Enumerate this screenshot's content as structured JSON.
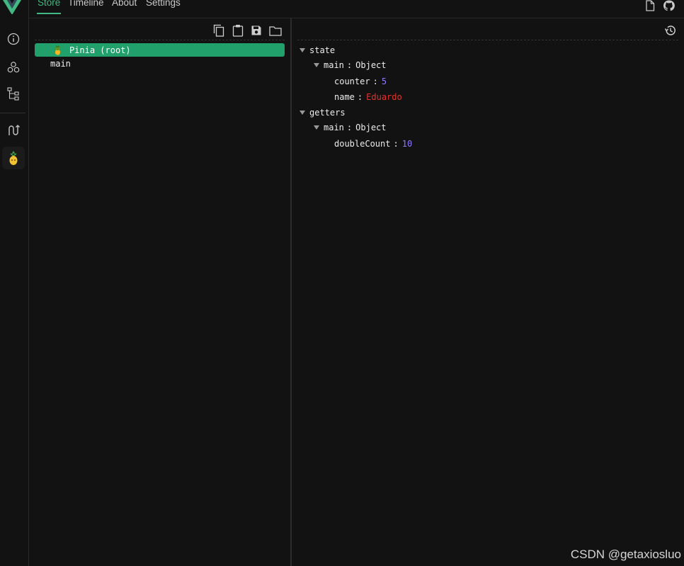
{
  "nav": {
    "tabs": [
      {
        "label": "Store",
        "active": true
      },
      {
        "label": "Timeline",
        "active": false
      },
      {
        "label": "About",
        "active": false
      },
      {
        "label": "Settings",
        "active": false
      }
    ]
  },
  "sidebar": {
    "icons": [
      "vue-logo-icon",
      "info-icon",
      "components-icon",
      "component-tree-icon",
      "routes-icon",
      "pinia-icon"
    ],
    "active_icon": "pinia-icon"
  },
  "toolbar": {
    "icons": [
      "copy-icon",
      "clipboard-icon",
      "save-icon",
      "folder-icon"
    ],
    "right_icons": [
      "document-icon",
      "github-icon"
    ]
  },
  "stores": [
    {
      "label": "Pinia (root)",
      "icon": "🍍",
      "selected": true
    },
    {
      "label": "main",
      "selected": false
    }
  ],
  "inspector": {
    "history_icon": "history-icon",
    "state_label": "state",
    "state_main_key": "main",
    "state_main_type": "Object",
    "counter_key": "counter",
    "counter_value": "5",
    "name_key": "name",
    "name_value": "Eduardo",
    "getters_label": "getters",
    "getters_main_key": "main",
    "getters_main_type": "Object",
    "double_key": "doubleCount",
    "double_value": "10"
  },
  "watermark": "CSDN @getaxiosluo",
  "colors": {
    "accent": "#42b883",
    "selected_bg": "#22a06b",
    "number": "#8f7bff",
    "string": "#e5322d",
    "background": "#121212"
  }
}
